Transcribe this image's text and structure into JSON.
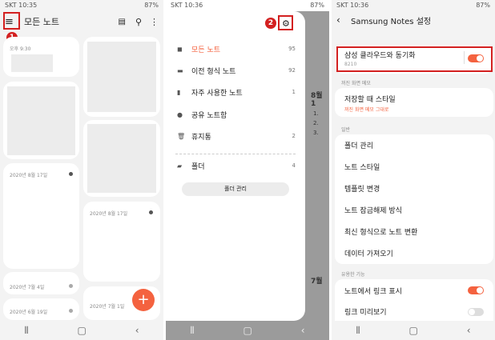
{
  "panel1": {
    "status_left": "SKT 10:35",
    "status_right": "87%",
    "title": "모든 노트",
    "notes": [
      {
        "date": "오후 9:30"
      },
      {
        "date": "2020년 8월 17일"
      },
      {
        "date": "2020년 8월 17일"
      },
      {
        "date": "2020년 7월 4일"
      },
      {
        "date": "2020년 7월 1일"
      },
      {
        "date": "2020년 6월 19일"
      }
    ],
    "fab": "+",
    "step_badge": "1"
  },
  "panel2": {
    "status_left": "SKT 10:36",
    "status_right": "87%",
    "step_badge": "2",
    "items": [
      {
        "label": "모든 노트",
        "count": "95"
      },
      {
        "label": "이전 형식 노트",
        "count": "92"
      },
      {
        "label": "자주 사용한 노트",
        "count": "1"
      },
      {
        "label": "공유 노트함",
        "count": ""
      },
      {
        "label": "휴지통",
        "count": "2"
      }
    ],
    "folder": {
      "label": "폴더",
      "count": "4"
    },
    "folder_manage": "폴더 관리",
    "bg_texts": {
      "b1": "8월 1",
      "b2": "7월 ",
      "b3": "1.",
      "b4": "2.",
      "b5": "3."
    }
  },
  "panel3": {
    "status_left": "SKT 10:36",
    "status_right": "87%",
    "title": "Samsung Notes 설정",
    "sync": {
      "label": "삼성 클라우드와 동기화",
      "sub": "8210"
    },
    "sec_screen_off": "꺼진 화면 메모",
    "save_style": {
      "label": "저장할 때 스타일",
      "sub": "꺼진 화면 메모 그대로"
    },
    "sec_general": "일반",
    "general_items": [
      "폴더 관리",
      "노트 스타일",
      "템플릿 변경",
      "노트 잠금해제 방식",
      "최신 형식으로 노트 변환",
      "데이터 가져오기"
    ],
    "sec_useful": "유용한 기능",
    "useful_items": [
      {
        "label": "노트에서 링크 표시",
        "on": true
      },
      {
        "label": "링크 미리보기",
        "on": false
      }
    ]
  },
  "colors": {
    "accent": "#f4623f",
    "highlight": "#d32020"
  }
}
